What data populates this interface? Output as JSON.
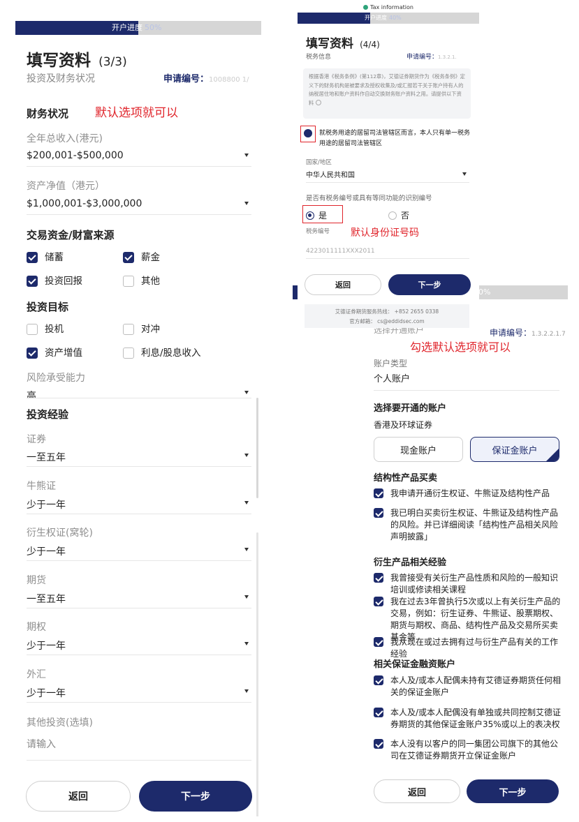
{
  "left": {
    "progress_label": "开户进度",
    "progress_value": "50%",
    "progress_fraction": 0.5,
    "title": "填写资料",
    "step": "(3/3)",
    "subtitle": "投资及财务状况",
    "app_no_label": "申请编号：",
    "app_no_value": "1008800 1/",
    "annotation": "默认选项就可以",
    "finance_heading": "财务状况",
    "income_label": "全年总收入(港元)",
    "income_value": "$200,001-$500,000",
    "networth_label": "资产净值（港元）",
    "networth_value": "$1,000,001-$3,000,000",
    "source_heading": "交易资金/财富来源",
    "source_options": [
      {
        "label": "储蓄",
        "checked": true
      },
      {
        "label": "薪金",
        "checked": true
      },
      {
        "label": "投资回报",
        "checked": true
      },
      {
        "label": "其他",
        "checked": false
      }
    ],
    "goal_heading": "投资目标",
    "goal_options": [
      {
        "label": "投机",
        "checked": false
      },
      {
        "label": "对冲",
        "checked": false
      },
      {
        "label": "资产增值",
        "checked": true
      },
      {
        "label": "利息/股息收入",
        "checked": false
      }
    ],
    "risk_label": "风险承受能力",
    "risk_value": "高",
    "exp_heading": "投资经验",
    "experience": [
      {
        "label": "证券",
        "value": "一至五年"
      },
      {
        "label": "牛熊证",
        "value": "少于一年"
      },
      {
        "label": "衍生权证(窝轮)",
        "value": "少于一年"
      },
      {
        "label": "期货",
        "value": "一至五年"
      },
      {
        "label": "期权",
        "value": "少于一年"
      },
      {
        "label": "外汇",
        "value": "少于一年"
      }
    ],
    "other_label": "其他投资(选填)",
    "other_placeholder": "请输入",
    "back_label": "返回",
    "next_label": "下一步"
  },
  "tax": {
    "top_caption": "Tax information",
    "progress_label": "开户进度",
    "progress_value": "40%",
    "progress_fraction": 0.4,
    "title": "填写资料",
    "step": "(4/4)",
    "section": "税务信息",
    "app_no_label": "申请编号：",
    "app_no_value": "1.3.2.1.",
    "notice": "根据香港《税务条例》(第112章)，艾德证券期货作为《税务条例》定义下的财务机构是被要求及授权收集及/或汇报若干关于账户持有人的纳税居住地和账户资料作自动交换财务账户资料之用。请提供以下资料",
    "single_residency": "就税务用途的居留司法管辖区而言，本人只有单一税务用途的居留司法管辖区",
    "country_label": "国家/地区",
    "country_value": "中华人民共和国",
    "tin_question": "是否有税务编号或具有等同功能的识别编号",
    "yes_label": "是",
    "no_label": "否",
    "tin_label": "税务编号",
    "tin_value": "4223011111XXX2011",
    "annotation": "默认身份证号码",
    "back_label": "返回",
    "next_label": "下一步",
    "hotline": "艾德证券期货服务热线：  +852 2655 0338",
    "email": "官方邮箱：  cs@eddidsec.com"
  },
  "acct": {
    "progress_value": "0%",
    "progress_fraction": 0.3,
    "app_no_label": "申请编号：",
    "app_no_value": "1.3.2.2.1.7",
    "select_hint": "选择开通账户",
    "annotation": "勾选默认选项就可以",
    "type_label": "账户类型",
    "type_value": "个人账户",
    "choose_heading": "选择要开通的账户",
    "market": "香港及环球证券",
    "cash_label": "现金账户",
    "margin_label": "保证金账户",
    "structured_heading": "结构性产品买卖",
    "structured_items": [
      "我申请开通衍生权证、牛熊证及结构性产品",
      "我已明白买卖衍生权证、牛熊证及结构性产品的风险。并已详细阅读「结构性产品相关风险声明披露」"
    ],
    "deriv_heading": "衍生产品相关经验",
    "deriv_items": [
      "我曾接受有关衍生产品性质和风险的一般知识培训或修读相关课程",
      "我在过去3年曾执行5次或以上有关衍生产品的交易，例如：衍生证券、牛熊证、股票期权、期货与期权、商品、结构性产品及交易所买卖基金等",
      "我从现在或过去拥有过与衍生产品有关的工作经验"
    ],
    "margin_heading": "相关保证金融资账户",
    "margin_items": [
      "本人及/或本人配偶未持有艾德证券期货任何相关的保证金账户",
      "本人及/或本人配偶没有单独或共同控制艾德证券期货的其他保证金账户35%或以上的表决权",
      "本人没有以客户的同一集团公司旗下的其他公司在艾德证券期货开立保证金账户"
    ],
    "back_label": "返回",
    "next_label": "下一步"
  }
}
